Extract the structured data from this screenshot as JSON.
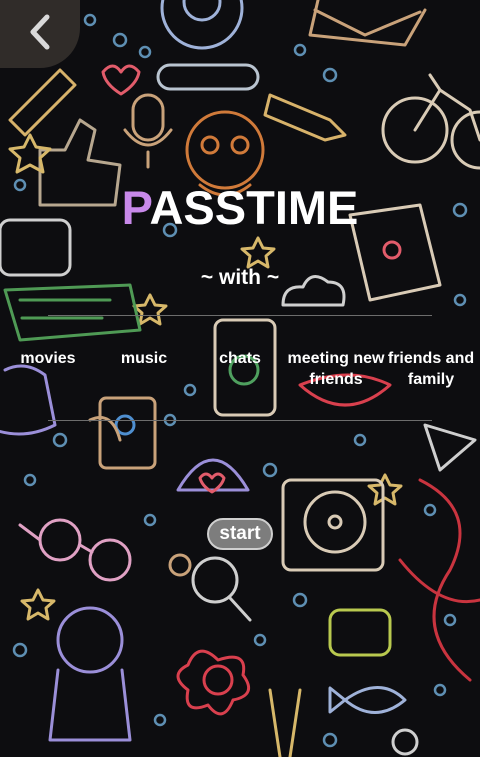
{
  "header": {
    "back_icon": "chevron-left-icon"
  },
  "title": {
    "accent_letter": "P",
    "rest": "ASSTIME"
  },
  "subtitle": "~ with ~",
  "topics": [
    {
      "label": "movies"
    },
    {
      "label": "music"
    },
    {
      "label": "chats"
    },
    {
      "label": "meeting new friends"
    },
    {
      "label": "friends and family"
    }
  ],
  "start_label": "start",
  "colors": {
    "accent": "#c889ea",
    "background": "#0d0d10",
    "button": "#7d7d7d"
  }
}
